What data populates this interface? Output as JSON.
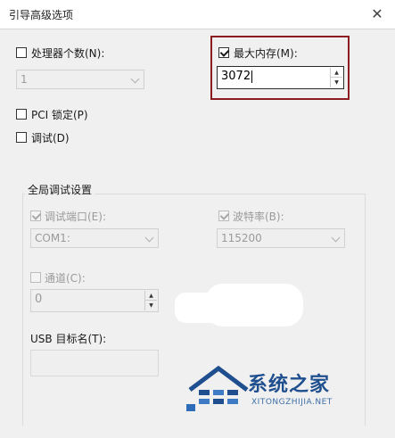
{
  "window": {
    "title": "引导高级选项",
    "close_glyph": "✕"
  },
  "options": {
    "processors": {
      "label": "处理器个数(N):",
      "checked": false,
      "value": "1"
    },
    "max_memory": {
      "label": "最大内存(M):",
      "checked": true,
      "value": "3072"
    },
    "pci_lock": {
      "label": "PCI 锁定(P)",
      "checked": false
    },
    "debug": {
      "label": "调试(D)",
      "checked": false
    }
  },
  "global_debug": {
    "title": "全局调试设置",
    "debug_port": {
      "label": "调试端口(E):",
      "checked": true,
      "value": "COM1:"
    },
    "baud_rate": {
      "label": "波特率(B):",
      "checked": true,
      "value": "115200"
    },
    "channel": {
      "label": "通道(C):",
      "checked": false,
      "value": "0"
    },
    "usb_target": {
      "label": "USB 目标名(T):",
      "value": ""
    }
  },
  "watermark": {
    "brand": "系统之家",
    "url": "XITONGZHIJIA.NET"
  },
  "icons": {
    "close": "close-icon",
    "chevron": "chevron-down-icon",
    "spin_up": "spin-up-icon",
    "spin_down": "spin-down-icon"
  },
  "colors": {
    "highlight_border": "#8b1c22",
    "brand_blue": "#1f4f8e"
  }
}
